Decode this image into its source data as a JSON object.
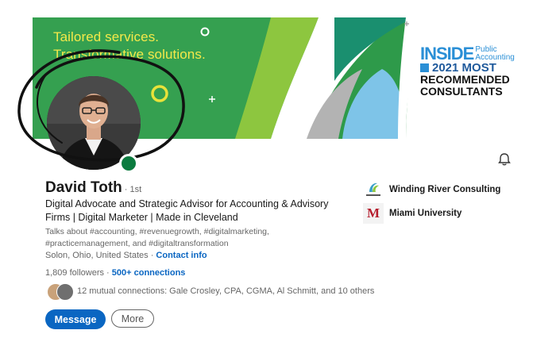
{
  "banner": {
    "tagline_line1": "Tailored services.",
    "tagline_line2": "Transformative solutions.",
    "award_inside": "INSIDE",
    "award_publication": "Public Accounting",
    "award_year": "2021 MOST",
    "award_line2": "RECOMMENDED",
    "award_line3": "CONSULTANTS"
  },
  "profile": {
    "name": "David Toth",
    "degree": "· 1st",
    "headline": "Digital Advocate and Strategic Advisor for Accounting & Advisory Firms | Digital Marketer | Made in Cleveland",
    "talks_about": "Talks about #accounting, #revenuegrowth, #digitalmarketing, #practicemanagement, and #digitaltransformation",
    "location": "Solon, Ohio, United States",
    "separator": " · ",
    "contact_info": "Contact info",
    "followers": "1,809 followers",
    "connections": "500+ connections",
    "mutual": "12 mutual connections: Gale Crosley, CPA, CGMA, Al Schmitt, and 10 others"
  },
  "actions": {
    "message": "Message",
    "more": "More"
  },
  "organizations": [
    {
      "name": "Winding River Consulting",
      "icon": "winding-river-logo"
    },
    {
      "name": "Miami University",
      "icon": "miami-university-logo"
    }
  ],
  "colors": {
    "accent": "#0a66c2",
    "banner_green": "#2e9a4a",
    "status_green": "#0b7b3f",
    "tagline_yellow": "#f4e94a"
  }
}
